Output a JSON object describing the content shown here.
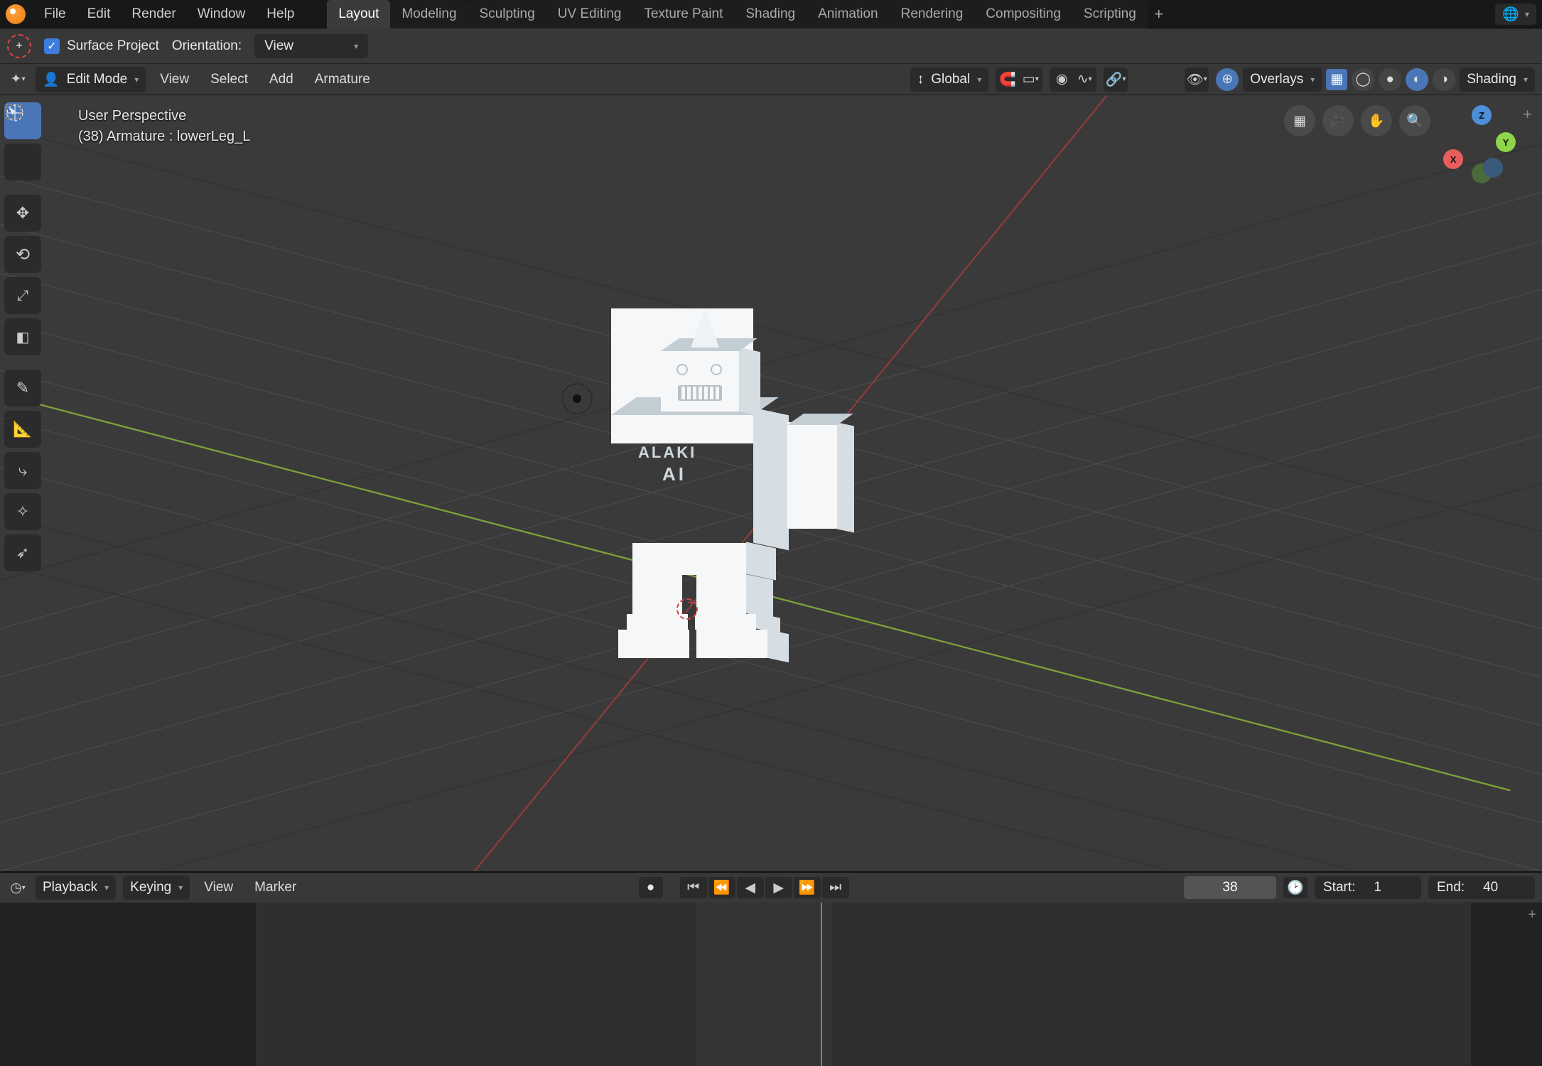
{
  "top_menu": {
    "items": [
      "File",
      "Edit",
      "Render",
      "Window",
      "Help"
    ]
  },
  "workspaces": {
    "tabs": [
      "Layout",
      "Modeling",
      "Sculpting",
      "UV Editing",
      "Texture Paint",
      "Shading",
      "Animation",
      "Rendering",
      "Compositing",
      "Scripting"
    ],
    "active": 0
  },
  "tool_header": {
    "surface_project_checked": true,
    "surface_project_label": "Surface Project",
    "orientation_label": "Orientation:",
    "orientation_value": "View"
  },
  "view_header": {
    "mode": "Edit Mode",
    "menus": [
      "View",
      "Select",
      "Add",
      "Armature"
    ],
    "transform_orientation": "Global",
    "overlays_label": "Overlays",
    "shading_label": "Shading"
  },
  "hud": {
    "line1": "User Perspective",
    "line2": "(38) Armature : lowerLeg_L"
  },
  "nav_axes": {
    "x": "X",
    "y": "Y",
    "z": "Z"
  },
  "robot_text": {
    "line1": "ALAKI",
    "line2": "AI"
  },
  "timeline_header": {
    "playback_label": "Playback",
    "keying_label": "Keying",
    "menus": [
      "View",
      "Marker"
    ],
    "current_frame": "38",
    "start_label": "Start:",
    "start_value": "1",
    "end_label": "End:",
    "end_value": "40"
  }
}
